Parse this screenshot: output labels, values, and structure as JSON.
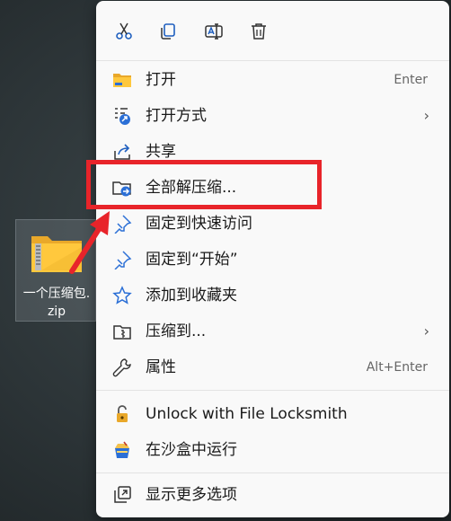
{
  "desktop": {
    "file_label_line1": "一个压缩包.",
    "file_label_line2": "zip"
  },
  "toolbar": {
    "cut": "cut-icon",
    "copy": "copy-icon",
    "rename": "rename-icon",
    "delete": "delete-icon"
  },
  "menu": {
    "items": [
      {
        "label": "打开",
        "shortcut": "Enter",
        "icon": "folder-icon"
      },
      {
        "label": "打开方式",
        "icon": "open-with-icon",
        "submenu": "›"
      },
      {
        "label": "共享",
        "icon": "share-icon"
      },
      {
        "label": "全部解压缩...",
        "icon": "extract-icon"
      },
      {
        "label": "固定到快速访问",
        "icon": "pin-icon"
      },
      {
        "label": "固定到“开始”",
        "icon": "pin-icon"
      },
      {
        "label": "添加到收藏夹",
        "icon": "star-icon"
      },
      {
        "label": "压缩到...",
        "icon": "compress-icon",
        "submenu": "›"
      },
      {
        "label": "属性",
        "shortcut": "Alt+Enter",
        "icon": "wrench-icon"
      },
      {
        "label": "Unlock with File Locksmith",
        "icon": "lock-icon"
      },
      {
        "label": "在沙盒中运行",
        "icon": "sandbox-icon"
      },
      {
        "label": "显示更多选项",
        "icon": "more-options-icon"
      }
    ]
  },
  "colors": {
    "highlight": "#e8242a",
    "accent": "#2b6fd6"
  }
}
